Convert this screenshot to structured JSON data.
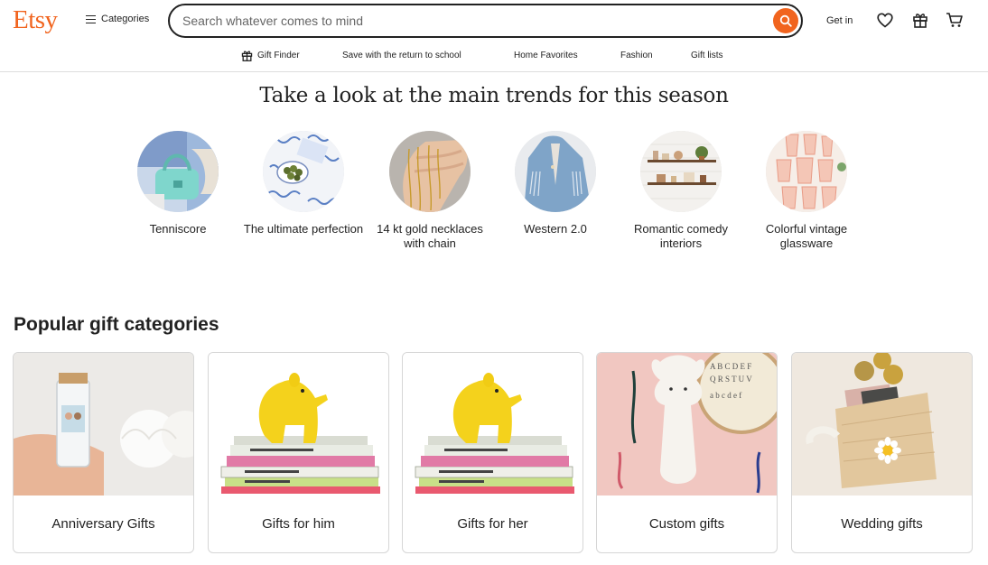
{
  "header": {
    "logo": "Etsy",
    "categories_label": "Categories",
    "search_placeholder": "Search whatever comes to mind",
    "signin_label": "Get in"
  },
  "subnav": {
    "items": [
      {
        "label": "Gift Finder",
        "icon": "gift-icon"
      },
      {
        "label": "Save with the return to school"
      },
      {
        "label": "Home Favorites"
      },
      {
        "label": "Fashion"
      },
      {
        "label": "Gift lists"
      }
    ]
  },
  "trends": {
    "title": "Take a look at the main trends for this season",
    "items": [
      {
        "label": "Tenniscore"
      },
      {
        "label": "The ultimate perfection"
      },
      {
        "label": "14 kt gold necklaces with chain"
      },
      {
        "label": "Western 2.0"
      },
      {
        "label": "Romantic comedy interiors"
      },
      {
        "label": "Colorful vintage glassware"
      }
    ]
  },
  "popular": {
    "title": "Popular gift categories",
    "cards": [
      {
        "label": "Anniversary Gifts"
      },
      {
        "label": "Gifts for him"
      },
      {
        "label": "Gifts for her"
      },
      {
        "label": "Custom gifts"
      },
      {
        "label": "Wedding gifts"
      }
    ]
  },
  "colors": {
    "brand": "#F1641E",
    "text": "#222222",
    "border": "#d6d6d6"
  }
}
